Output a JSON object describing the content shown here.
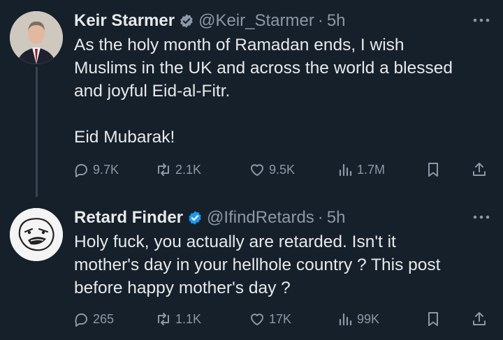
{
  "tweets": [
    {
      "name": "Keir Starmer",
      "handle": "@Keir_Starmer",
      "separator": "·",
      "time": "5h",
      "lines": [
        "As the holy month of Ramadan ends, I wish",
        "Muslims in the UK and across the world a blessed",
        "and joyful Eid-al-Fitr."
      ],
      "lines2": [
        "Eid Mubarak!"
      ],
      "replies": "9.7K",
      "reposts": "2.1K",
      "likes": "9.5K",
      "views": "1.7M"
    },
    {
      "name": "Retard Finder",
      "handle": "@IfindRetards",
      "separator": "·",
      "time": "5h",
      "lines": [
        "Holy fuck, you actually are retarded. Isn't it",
        "mother's day in your hellhole country ? This post",
        "before happy mother's day ?"
      ],
      "replies": "265",
      "reposts": "1.1K",
      "likes": "17K",
      "views": "99K"
    }
  ],
  "colors": {
    "background": "#16202b",
    "text": "#e7e9ea",
    "muted": "#8b98a5",
    "verified": "#1d9bf0"
  },
  "icons": [
    "verified-badge-icon",
    "more-icon",
    "reply-icon",
    "repost-icon",
    "like-icon",
    "views-icon",
    "bookmark-icon",
    "share-icon"
  ]
}
